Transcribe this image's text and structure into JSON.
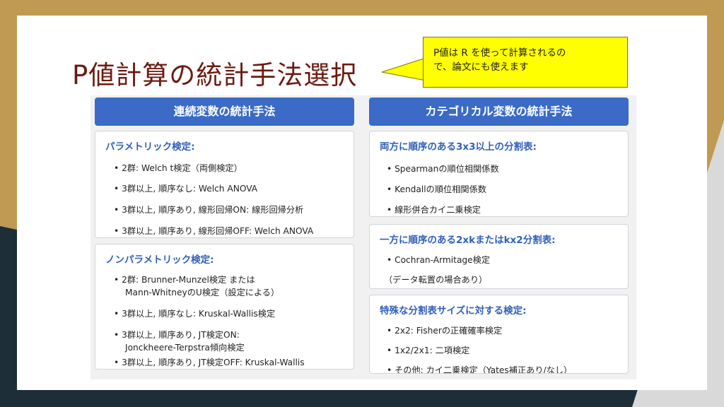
{
  "title": "P値計算の統計手法選択",
  "callout": {
    "line1": "P値は R を使って計算されるの",
    "line2": "で、論文にも使えます"
  },
  "columns": {
    "left": {
      "header": "連続変数の統計手法",
      "cards": [
        {
          "title": "パラメトリック検定:",
          "items": [
            "• 2群: Welch t検定（両側検定）",
            "• 3群以上, 順序なし: Welch ANOVA",
            "• 3群以上, 順序あり, 線形回帰ON: 線形回帰分析",
            "• 3群以上, 順序あり, 線形回帰OFF: Welch ANOVA"
          ]
        },
        {
          "title": "ノンパラメトリック検定:",
          "items": [
            "• 2群: Brunner-Munzel検定 または",
            "Mann-WhitneyのU検定（設定による）",
            "• 3群以上, 順序なし: Kruskal-Wallis検定",
            "• 3群以上, 順序あり, JT検定ON:",
            "Jonckheere-Terpstra傾向検定",
            "• 3群以上, 順序あり, JT検定OFF: Kruskal-Wallis"
          ]
        }
      ]
    },
    "right": {
      "header": "カテゴリカル変数の統計手法",
      "cards": [
        {
          "title": "両方に順序のある3x3以上の分割表:",
          "items": [
            "• Spearmanの順位相関係数",
            "• Kendallの順位相関係数",
            "• 線形併合カイ二乗検定"
          ]
        },
        {
          "title": "一方に順序のある2xkまたはkx2分割表:",
          "items": [
            "• Cochran-Armitage検定",
            "（データ転置の場合あり）"
          ]
        },
        {
          "title": "特殊な分割表サイズに対する検定:",
          "items": [
            "• 2x2: Fisherの正確確率検定",
            "• 1x2/2x1: 二項検定",
            "• その他: カイ二乗検定（Yates補正あり/なし）"
          ]
        }
      ]
    }
  }
}
